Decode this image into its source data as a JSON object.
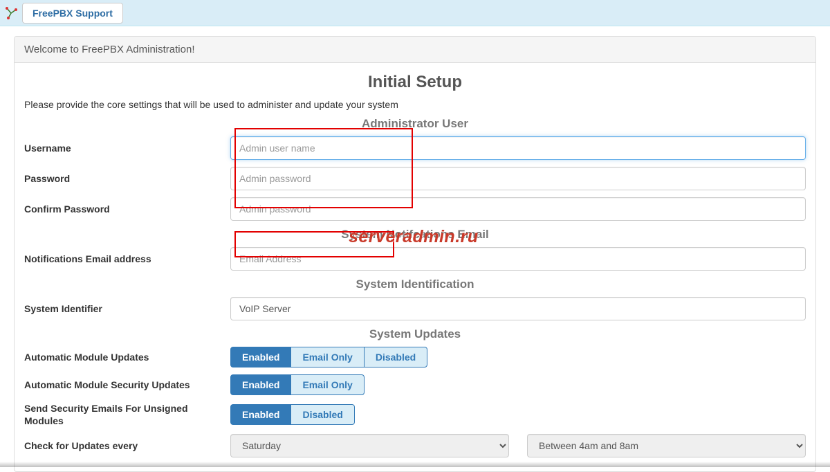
{
  "topbar": {
    "support_label": "FreePBX Support"
  },
  "panel": {
    "heading": "Welcome to FreePBX Administration!",
    "title": "Initial Setup",
    "instructions": "Please provide the core settings that will be used to administer and update your system"
  },
  "sections": {
    "admin_user": "Administrator User",
    "notifications": "System Notifcations Email",
    "identification": "System Identification",
    "updates": "System Updates"
  },
  "fields": {
    "username": {
      "label": "Username",
      "placeholder": "Admin user name",
      "value": ""
    },
    "password": {
      "label": "Password",
      "placeholder": "Admin password",
      "value": ""
    },
    "confirm_password": {
      "label": "Confirm Password",
      "placeholder": "Admin password",
      "value": ""
    },
    "notify_email": {
      "label": "Notifications Email address",
      "placeholder": "Email Address",
      "value": ""
    },
    "system_identifier": {
      "label": "System Identifier",
      "placeholder": "",
      "value": "VoIP Server"
    }
  },
  "updates": {
    "auto_module": {
      "label": "Automatic Module Updates",
      "options": [
        "Enabled",
        "Email Only",
        "Disabled"
      ],
      "selected": "Enabled"
    },
    "auto_security": {
      "label": "Automatic Module Security Updates",
      "options": [
        "Enabled",
        "Email Only"
      ],
      "selected": "Enabled"
    },
    "unsigned_emails": {
      "label": "Send Security Emails For Unsigned Modules",
      "options": [
        "Enabled",
        "Disabled"
      ],
      "selected": "Enabled"
    },
    "check_every": {
      "label": "Check for Updates every",
      "day": "Saturday",
      "time": "Between 4am and 8am"
    }
  },
  "watermark": "serveradmin.ru"
}
